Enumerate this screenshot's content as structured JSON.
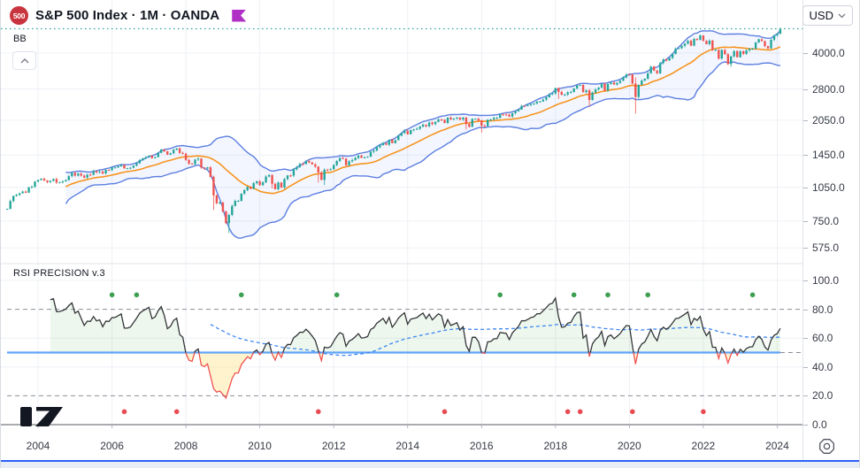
{
  "header": {
    "symbol_badge": "500",
    "title": "S&P 500 Index · 1M · OANDA",
    "currency_button": "USD"
  },
  "main_pane": {
    "indicator_label": "BB",
    "price_axis": [
      {
        "label": "4000.0",
        "value": 4000
      },
      {
        "label": "2800.0",
        "value": 2800
      },
      {
        "label": "2050.0",
        "value": 2050
      },
      {
        "label": "1450.0",
        "value": 1450
      },
      {
        "label": "1050.0",
        "value": 1050
      },
      {
        "label": "750.0",
        "value": 750
      },
      {
        "label": "575.0",
        "value": 575
      }
    ]
  },
  "rsi_pane": {
    "label": "RSI PRECISION v.3",
    "axis": [
      {
        "label": "100.0",
        "value": 100
      },
      {
        "label": "80.0",
        "value": 80
      },
      {
        "label": "60.0",
        "value": 60
      },
      {
        "label": "40.0",
        "value": 40
      },
      {
        "label": "20.0",
        "value": 20
      },
      {
        "label": "0.0",
        "value": 0
      }
    ]
  },
  "time_axis": {
    "labels": [
      "2004",
      "2006",
      "2008",
      "2010",
      "2012",
      "2014",
      "2016",
      "2018",
      "2020",
      "2022",
      "2024"
    ]
  },
  "chart_data": {
    "type": "candlestick",
    "symbol": "S&P 500 Index",
    "timeframe": "1M",
    "exchange": "OANDA",
    "price_scale": "log",
    "start_month": "2003-03",
    "monthly_closes": [
      848,
      917,
      964,
      975,
      990,
      1008,
      996,
      1050,
      1058,
      1112,
      1131,
      1145,
      1126,
      1107,
      1121,
      1141,
      1102,
      1104,
      1115,
      1130,
      1174,
      1212,
      1181,
      1204,
      1181,
      1157,
      1192,
      1191,
      1234,
      1220,
      1229,
      1207,
      1249,
      1248,
      1280,
      1281,
      1295,
      1311,
      1270,
      1270,
      1277,
      1304,
      1336,
      1378,
      1401,
      1418,
      1438,
      1407,
      1421,
      1482,
      1531,
      1503,
      1455,
      1474,
      1527,
      1549,
      1481,
      1468,
      1379,
      1331,
      1323,
      1386,
      1400,
      1280,
      1267,
      1283,
      1166,
      969,
      896,
      903,
      826,
      735,
      798,
      873,
      919,
      919,
      987,
      1021,
      1057,
      1036,
      1096,
      1115,
      1074,
      1104,
      1169,
      1187,
      1089,
      1031,
      1102,
      1049,
      1141,
      1183,
      1181,
      1258,
      1286,
      1327,
      1326,
      1364,
      1345,
      1321,
      1292,
      1219,
      1131,
      1253,
      1247,
      1258,
      1312,
      1366,
      1408,
      1398,
      1310,
      1362,
      1379,
      1407,
      1441,
      1412,
      1416,
      1426,
      1498,
      1515,
      1569,
      1598,
      1631,
      1606,
      1686,
      1633,
      1682,
      1757,
      1806,
      1848,
      1783,
      1859,
      1872,
      1884,
      1924,
      1960,
      1931,
      2003,
      1972,
      2018,
      2068,
      2059,
      1995,
      2105,
      2068,
      2086,
      2107,
      2063,
      2104,
      1972,
      1920,
      2079,
      2080,
      2044,
      1940,
      1932,
      2060,
      2065,
      2097,
      2099,
      2174,
      2171,
      2168,
      2126,
      2199,
      2239,
      2279,
      2364,
      2363,
      2384,
      2412,
      2423,
      2470,
      2472,
      2519,
      2575,
      2648,
      2674,
      2824,
      2714,
      2641,
      2648,
      2705,
      2718,
      2816,
      2902,
      2914,
      2712,
      2760,
      2507,
      2704,
      2784,
      2834,
      2946,
      2752,
      2942,
      2980,
      2926,
      2977,
      3038,
      3141,
      3231,
      3226,
      2954,
      2585,
      2912,
      3044,
      3100,
      3271,
      3500,
      3363,
      3270,
      3622,
      3756,
      3714,
      3811,
      3973,
      4181,
      4204,
      4298,
      4395,
      4523,
      4308,
      4605,
      4567,
      4766,
      4516,
      4374,
      4530,
      4132,
      4132,
      3785,
      4130,
      3955,
      3586,
      3872,
      4080,
      3840,
      4077,
      3970,
      4109,
      4169,
      4180,
      4450,
      4589,
      4508,
      4288,
      4194,
      4568,
      4770,
      4846,
      5096
    ],
    "low_overrides": {
      "2008-10": 839,
      "2009-03": 666,
      "2010-05": 1040,
      "2011-08": 1101,
      "2011-10": 1074,
      "2015-08": 1867,
      "2016-01": 1812,
      "2018-02": 2532,
      "2018-12": 2346,
      "2020-03": 2192,
      "2022-10": 3491
    },
    "high_overrides": {
      "2020-03": 3137
    },
    "last_price": 5096,
    "indicators": {
      "bollinger": {
        "period": 20,
        "stddev": 2
      },
      "rsi": {
        "period": 14,
        "ma_window": 53,
        "upper_level": 80,
        "mid_level": 50,
        "lower_level": 20
      }
    },
    "signals": {
      "green_dot_level": 90,
      "green_dots": [
        "2006-01",
        "2006-09",
        "2009-07",
        "2012-02",
        "2016-07",
        "2018-07",
        "2019-06",
        "2020-07",
        "2023-05"
      ],
      "red_dot_level": 9,
      "red_dots": [
        "2006-05",
        "2007-10",
        "2011-08",
        "2015-01",
        "2018-05",
        "2018-09",
        "2020-02",
        "2022-01"
      ]
    }
  },
  "colors": {
    "candle_up": "#26a69a",
    "candle_down": "#ef5350",
    "bb_band": "#5c7fe0",
    "bb_fill": "rgba(41,98,255,0.055)",
    "bb_basis": "#f7941e",
    "price_line": "#26a69a",
    "rsi_line": "#333538",
    "rsi_line_neg": "#ef5350",
    "rsi_mid_line": "#4f9cf8",
    "rsi_ma_line": "#3f86f2",
    "rsi_fill_up": "rgba(76,175,80,0.10)",
    "rsi_fill_down": "rgba(255,214,92,0.30)",
    "level_dash": "#8b8e99",
    "dot_green": "#3d9f50",
    "dot_red": "#ea4a52",
    "grid": "#eef0f5",
    "badge_bg": "#c9353f",
    "flag": "#b02fc5",
    "logo": "#131722",
    "bottom_bar_accent": "#2d62f6"
  }
}
